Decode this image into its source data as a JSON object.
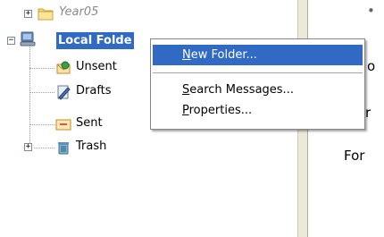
{
  "tree": {
    "items": [
      {
        "label": "Year05",
        "style": "archived"
      },
      {
        "label": "Local Folders",
        "visible_label": "Local Folde",
        "selected": true
      },
      {
        "label": "Unsent"
      },
      {
        "label": "Drafts"
      },
      {
        "label": "Sent"
      },
      {
        "label": "Trash"
      }
    ],
    "expander_plus": "+",
    "expander_minus": "−"
  },
  "context_menu": {
    "items": [
      {
        "prefix": "",
        "underline": "N",
        "rest": "ew Folder...",
        "highlighted": true
      },
      {
        "prefix": "",
        "underline": "S",
        "rest": "earch Messages..."
      },
      {
        "prefix": "",
        "underline": "P",
        "rest": "roperties..."
      }
    ]
  },
  "content": {
    "bullet": "•",
    "line1": "o",
    "line2": "r",
    "line3": "For"
  },
  "colors": {
    "selection": "#316ac5",
    "splitter": "#ece9d8"
  },
  "icons": {
    "year05": "folder-icon",
    "local_folders": "computer-icon",
    "unsent": "unsent-icon",
    "drafts": "drafts-icon",
    "sent": "sent-icon",
    "trash": "trash-icon"
  }
}
